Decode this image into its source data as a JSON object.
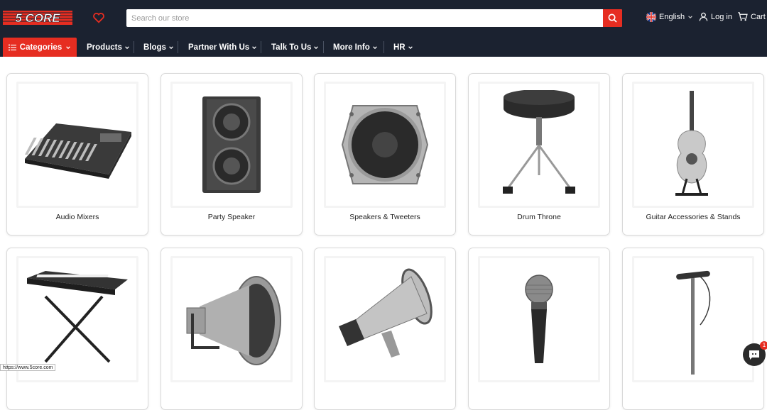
{
  "brand": {
    "logo_text": "5 CORE",
    "accent": "#e62d21",
    "header_bg": "#1b2230"
  },
  "search": {
    "placeholder": "Search our store"
  },
  "utility": {
    "language": "English",
    "login": "Log in",
    "cart": "Cart"
  },
  "nav": {
    "categories": "Categories",
    "items": [
      "Products",
      "Blogs",
      "Partner With Us",
      "Talk To Us",
      "More Info",
      "HR"
    ]
  },
  "products": [
    {
      "label": "Audio Mixers",
      "icon": "audio-mixer-image"
    },
    {
      "label": "Party Speaker",
      "icon": "party-speaker-image"
    },
    {
      "label": "Speakers & Tweeters",
      "icon": "speaker-driver-image"
    },
    {
      "label": "Drum Throne",
      "icon": "drum-throne-image"
    },
    {
      "label": "Guitar Accessories & Stands",
      "icon": "guitar-stand-image"
    },
    {
      "label": "",
      "icon": "keyboard-stand-image"
    },
    {
      "label": "",
      "icon": "horn-speaker-image"
    },
    {
      "label": "",
      "icon": "megaphone-image"
    },
    {
      "label": "",
      "icon": "microphone-image"
    },
    {
      "label": "",
      "icon": "mic-stand-image"
    }
  ],
  "status_url": "https://www.5core.com",
  "chat_badge": "1"
}
